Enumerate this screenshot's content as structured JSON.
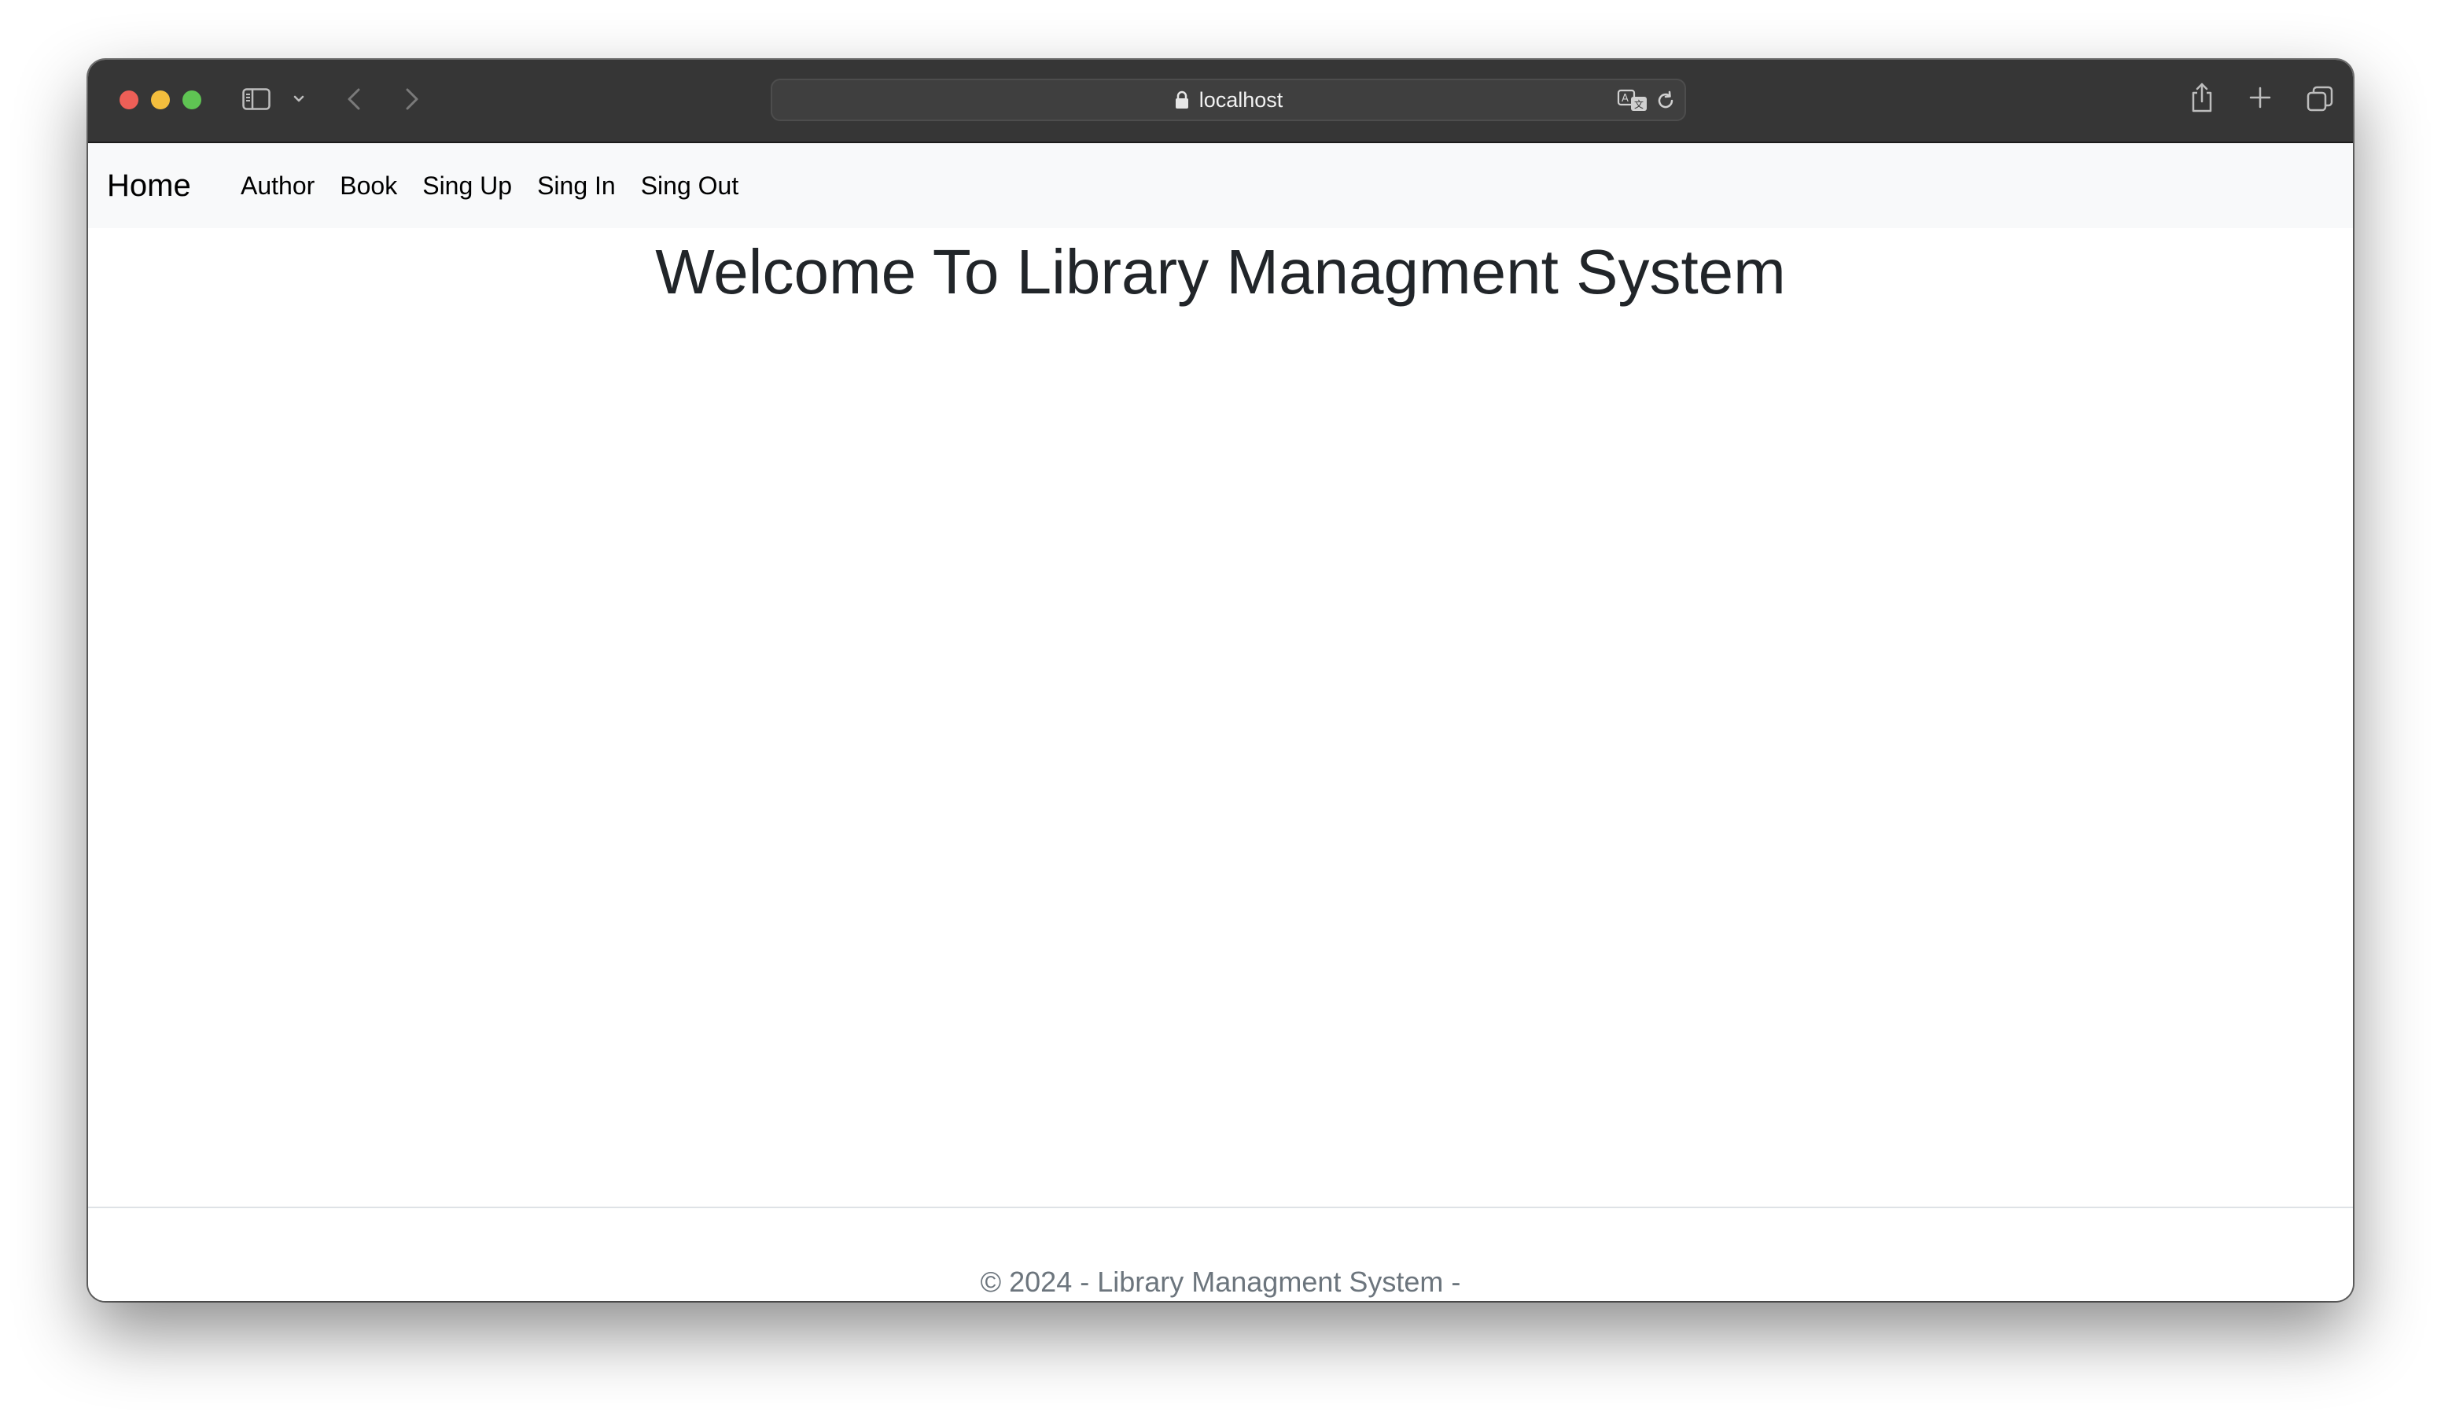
{
  "browser": {
    "url": "localhost",
    "buttons": {
      "close": "close-window",
      "minimize": "minimize-window",
      "maximize": "maximize-window"
    },
    "icons": [
      "sidebar-icon",
      "chevron-down-icon",
      "back-icon",
      "forward-icon",
      "lock-icon",
      "translate-icon",
      "reload-icon",
      "share-icon",
      "plus-icon",
      "tabs-icon"
    ],
    "colors": {
      "titlebar": "#363636",
      "close": "#ee5f57",
      "minimize": "#f4be3d",
      "maximize": "#5fc453"
    }
  },
  "navbar": {
    "brand": "Home",
    "links": [
      {
        "label": "Author"
      },
      {
        "label": "Book"
      },
      {
        "label": "Sing Up"
      },
      {
        "label": "Sing In"
      },
      {
        "label": "Sing Out"
      }
    ]
  },
  "main": {
    "heading": "Welcome To Library Managment System"
  },
  "footer": {
    "text": "© 2024 - Library Managment System -"
  }
}
